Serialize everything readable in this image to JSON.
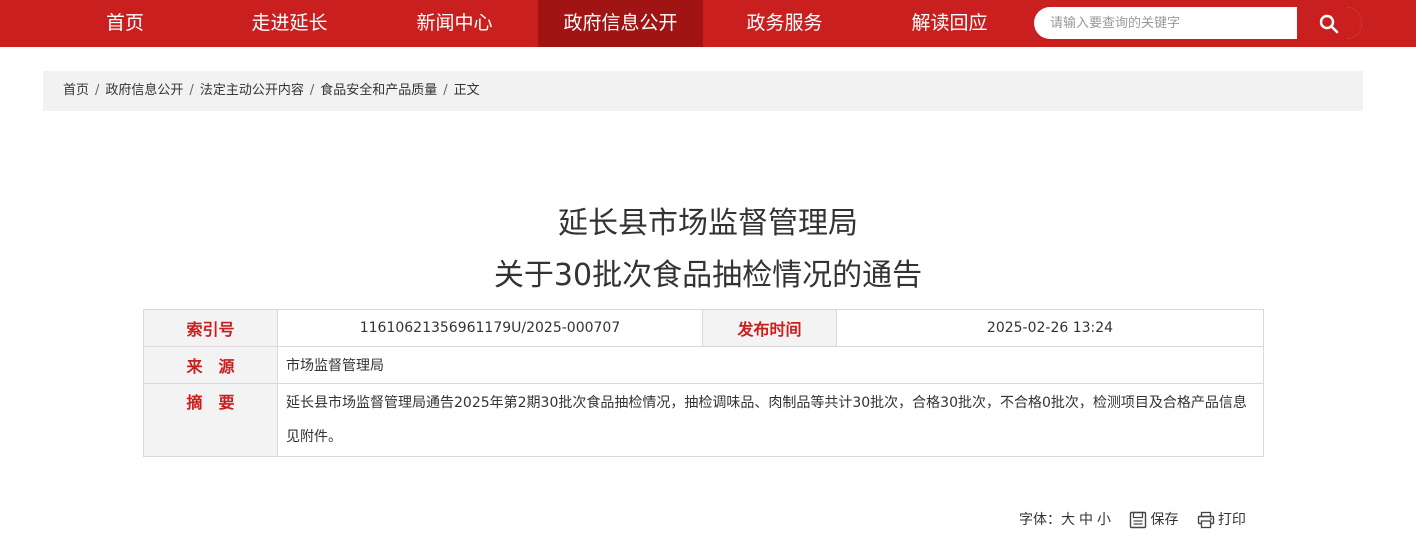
{
  "nav": {
    "items": [
      "首页",
      "走进延长",
      "新闻中心",
      "政府信息公开",
      "政务服务",
      "解读回应"
    ],
    "active_index": 3
  },
  "search": {
    "placeholder": "请输入要查询的关键字"
  },
  "breadcrumb": [
    "首页",
    "政府信息公开",
    "法定主动公开内容",
    "食品安全和产品质量",
    "正文"
  ],
  "article": {
    "title_line1": "延长县市场监督管理局",
    "title_line2": "关于30批次食品抽检情况的通告"
  },
  "meta": {
    "index_label": "索引号",
    "index_value": "11610621356961179U/2025-000707",
    "date_label": "发布时间",
    "date_value": "2025-02-26 13:24",
    "source_label": "来　源",
    "source_value": "市场监督管理局",
    "summary_label": "摘　要",
    "summary_value": "延长县市场监督管理局通告2025年第2期30批次食品抽检情况，抽检调味品、肉制品等共计30批次，合格30批次，不合格0批次，检测项目及合格产品信息见附件。"
  },
  "tools": {
    "font_label": "字体：",
    "font_large": "大",
    "font_medium": "中",
    "font_small": "小",
    "save_label": "保存",
    "print_label": "打印"
  },
  "colors": {
    "brand_red": "#c91f1f",
    "active_red": "#a01414"
  }
}
